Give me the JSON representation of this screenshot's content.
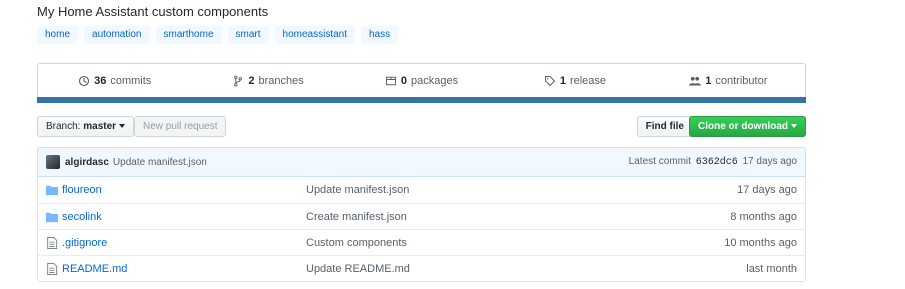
{
  "repo": {
    "description": "My Home Assistant custom components",
    "topics": [
      "home",
      "automation",
      "smarthome",
      "smart",
      "homeassistant",
      "hass"
    ]
  },
  "summary": {
    "commits_count": "36",
    "commits_label": "commits",
    "branches_count": "2",
    "branches_label": "branches",
    "packages_count": "0",
    "packages_label": "packages",
    "releases_count": "1",
    "releases_label": "release",
    "contributors_count": "1",
    "contributors_label": "contributor",
    "language_color": "#3572A5"
  },
  "toolbar": {
    "branch_prefix": "Branch:",
    "branch_name": "master",
    "new_pr_label": "New pull request",
    "find_file_label": "Find file",
    "clone_label": "Clone or download"
  },
  "latest_commit": {
    "author": "algirdasc",
    "message": "Update manifest.json",
    "prefix": "Latest commit",
    "sha": "6362dc6",
    "age": "17 days ago"
  },
  "files": [
    {
      "name": "floureon",
      "type": "folder",
      "message": "Update manifest.json",
      "age": "17 days ago"
    },
    {
      "name": "secolink",
      "type": "folder",
      "message": "Create manifest.json",
      "age": "8 months ago"
    },
    {
      "name": ".gitignore",
      "type": "file",
      "message": "Custom components",
      "age": "10 months ago"
    },
    {
      "name": "README.md",
      "type": "file",
      "message": "Update README.md",
      "age": "last month"
    }
  ]
}
